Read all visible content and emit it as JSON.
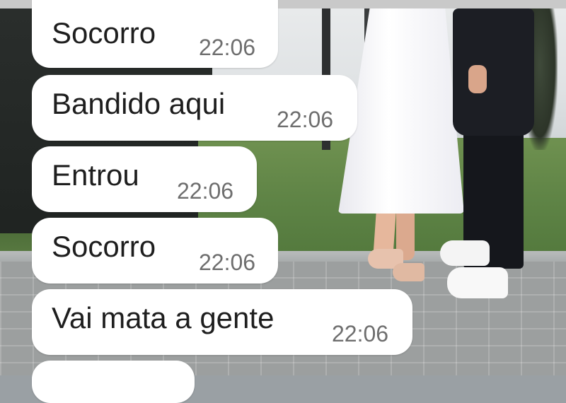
{
  "messages": [
    {
      "text": "Socorro",
      "time": "22:06"
    },
    {
      "text": "Bandido aqui",
      "time": "22:06"
    },
    {
      "text": "Entrou",
      "time": "22:06"
    },
    {
      "text": "Socorro",
      "time": "22:06"
    },
    {
      "text": "Vai mata a gente",
      "time": "22:06"
    }
  ],
  "colors": {
    "bubble": "#ffffff",
    "message_text": "#1e1e1e",
    "timestamp": "#6e6e6e"
  }
}
